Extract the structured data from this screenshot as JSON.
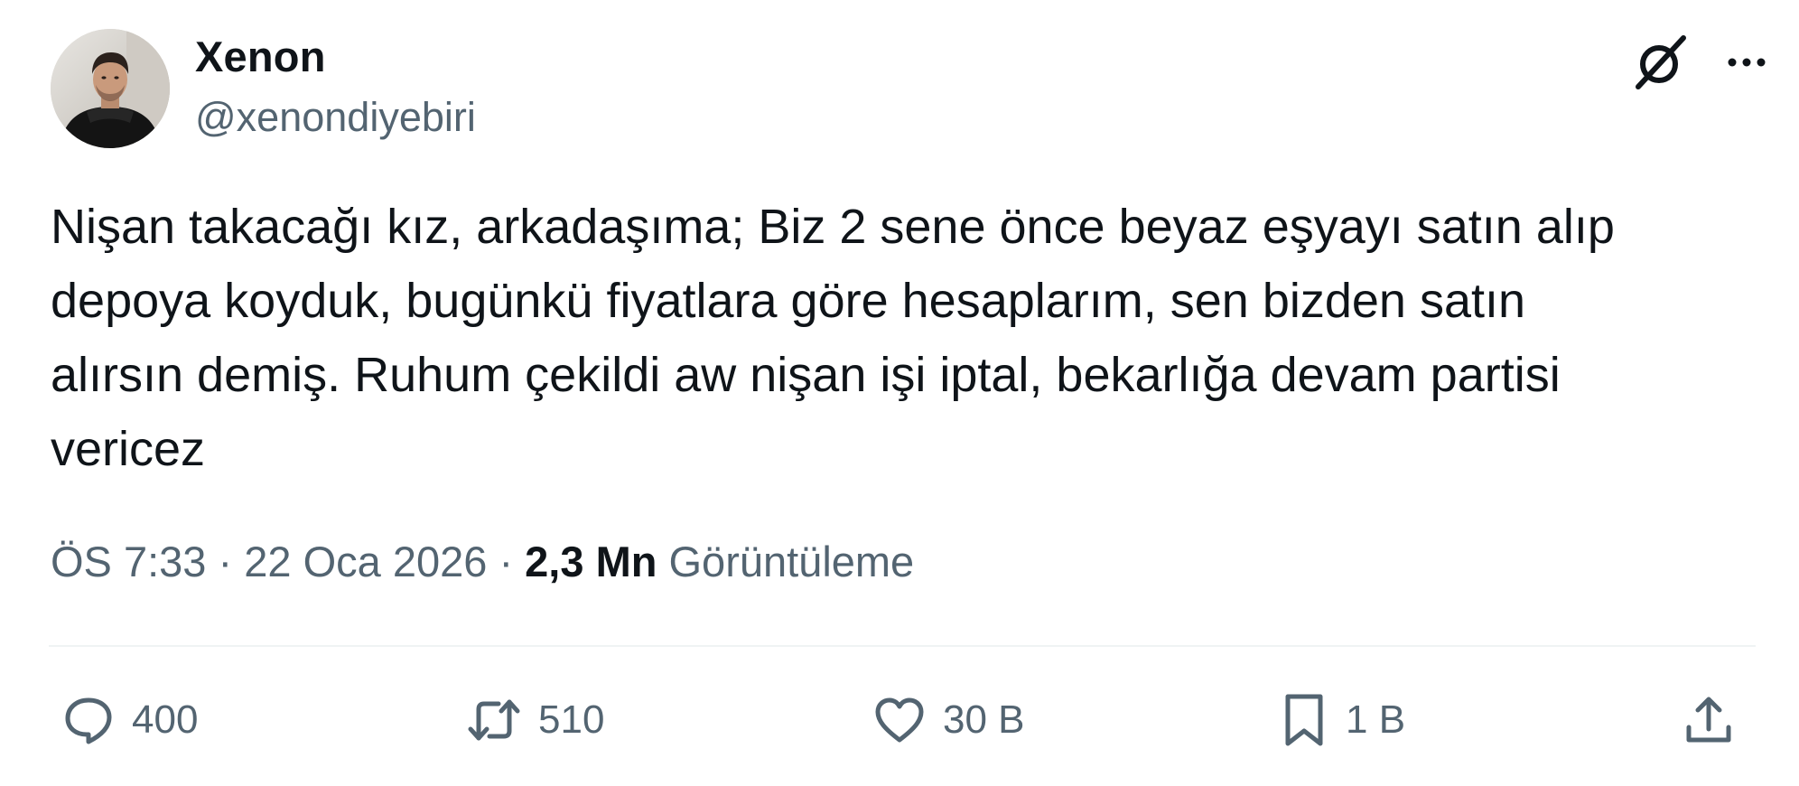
{
  "author": {
    "display_name": "Xenon",
    "handle": "@xenondiyebiri"
  },
  "icons": {
    "grok": "grok-icon",
    "more": "more-icon",
    "reply": "reply-icon",
    "retweet": "retweet-icon",
    "like": "heart-icon",
    "bookmark": "bookmark-icon",
    "share": "share-icon"
  },
  "tweet": {
    "text": "Nişan takacağı kız, arkadaşıma; Biz 2 sene önce beyaz eşyayı satın alıp\ndepoya koyduk, bugünkü fiyatlara göre hesaplarım, sen bizden satın\nalırsın demiş. Ruhum çekildi aw nişan işi iptal, bekarlığa devam partisi\nvericez"
  },
  "meta": {
    "time": "ÖS 7:33",
    "separator1": " · ",
    "date": "22 Oca 2026",
    "separator2": " · ",
    "views_count": "2,3 Mn",
    "views_label": "Görüntüleme"
  },
  "actions": {
    "replies": "400",
    "retweets": "510",
    "likes": "30 B",
    "bookmarks": "1 B"
  },
  "colors": {
    "text_primary": "#0f1419",
    "text_secondary": "#536471",
    "divider": "#eff3f4"
  }
}
